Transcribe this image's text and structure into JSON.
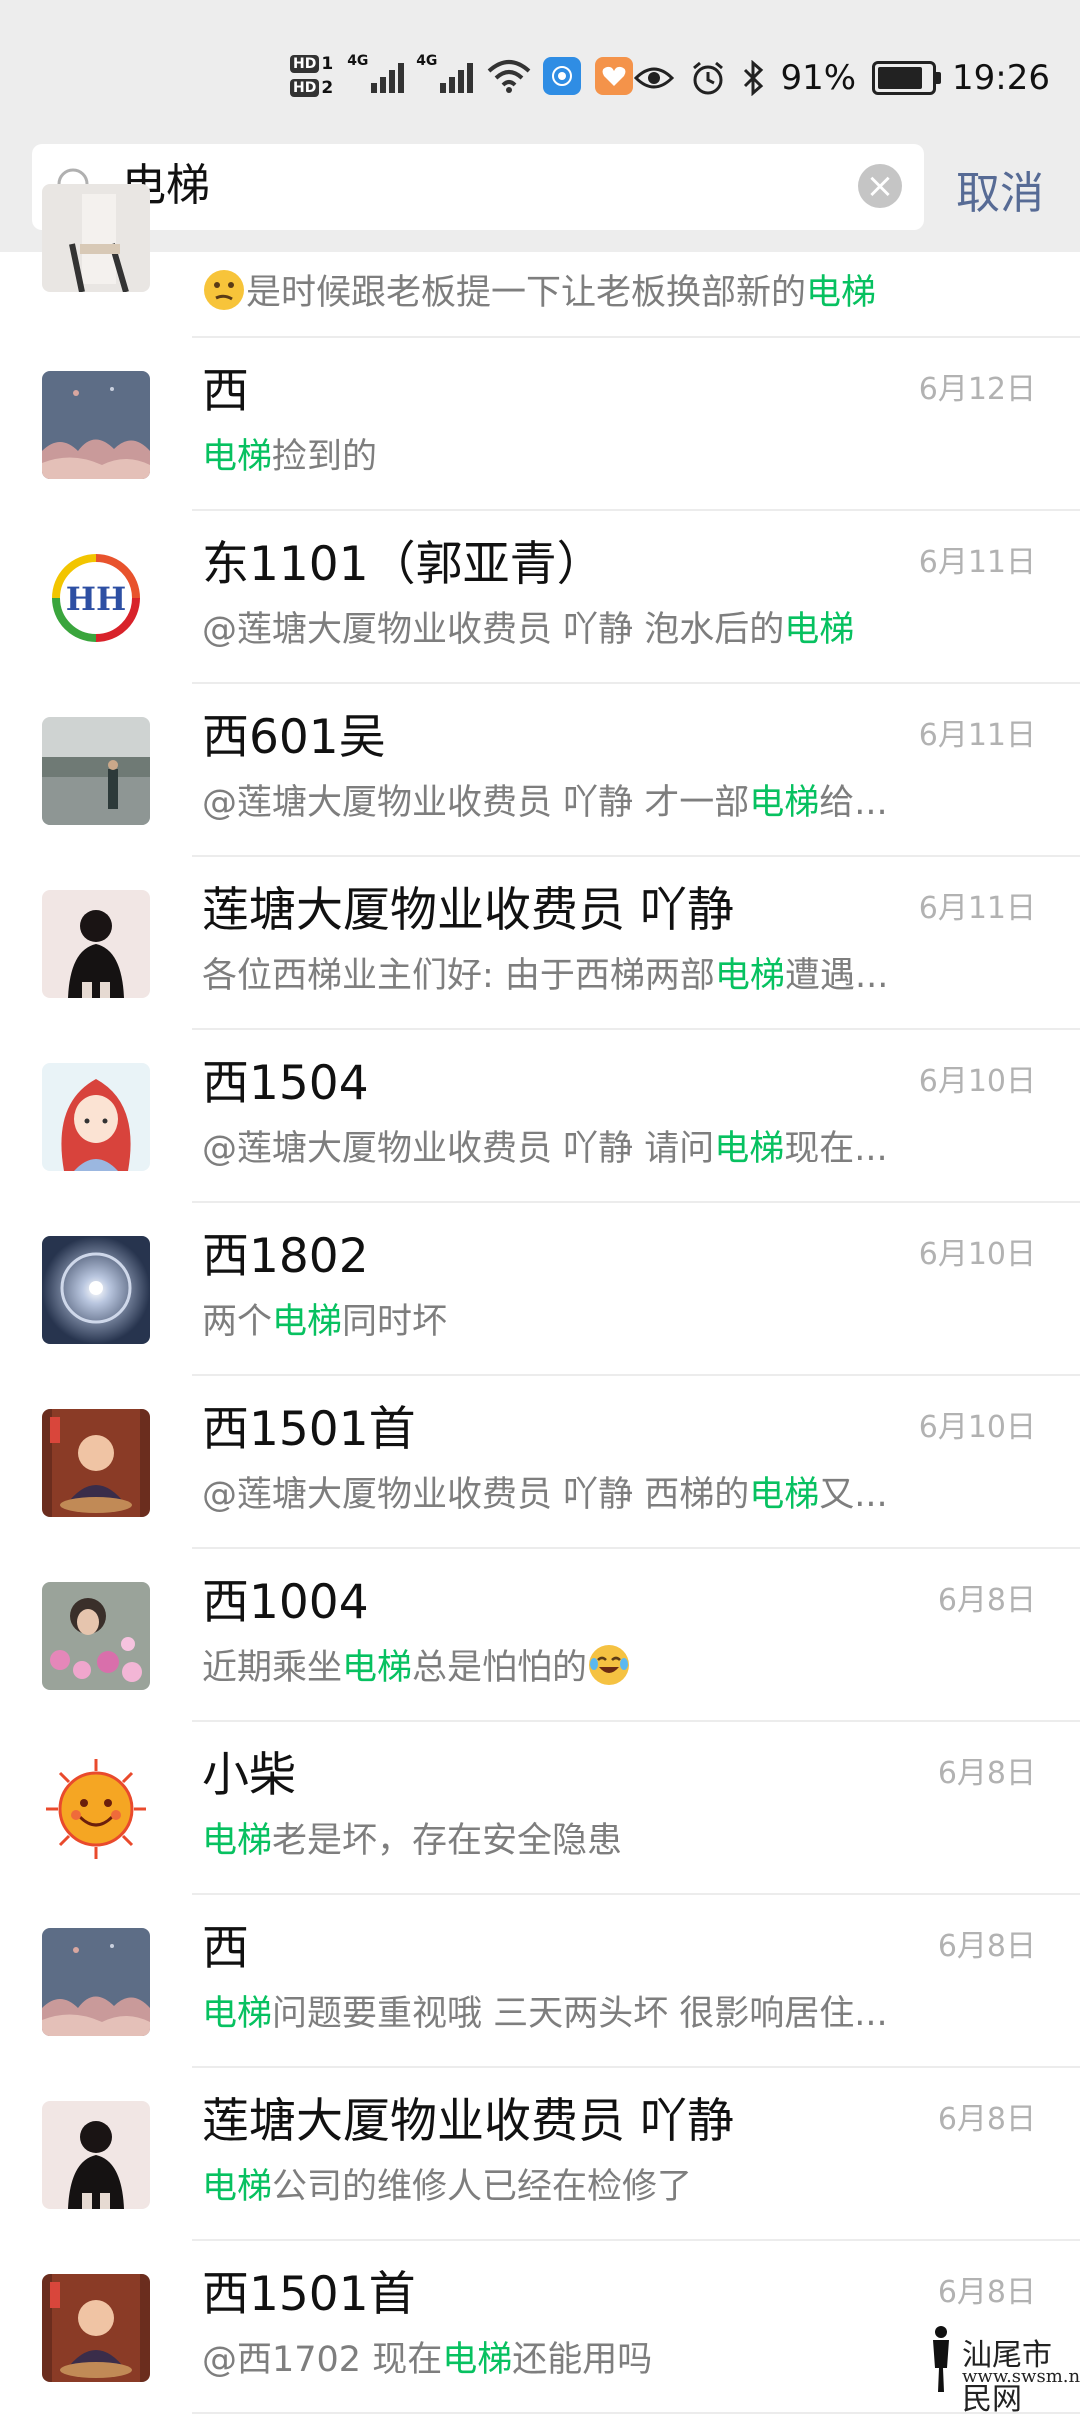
{
  "status_bar": {
    "hd1": "HD",
    "hd1_sub": "1",
    "hd2": "HD",
    "hd2_sub": "2",
    "net1": "4G",
    "net2": "4G",
    "battery_percent": "91%",
    "time": "19:26"
  },
  "search": {
    "query": "电梯",
    "clear_icon": "×",
    "cancel_label": "取消"
  },
  "results_partial": {
    "pre": "是时候跟老板提一下让老板换部新的",
    "hl": "电梯",
    "post": ""
  },
  "results": [
    {
      "name": "西",
      "date": "6月12日",
      "pre": "",
      "hl": "电梯",
      "post": "捡到的",
      "avatar": "landscape"
    },
    {
      "name": "东1101（郭亚青）",
      "date": "6月11日",
      "pre": "@莲塘大厦物业收费员  吖静 泡水后的",
      "hl": "电梯",
      "post": "",
      "avatar": "hh-logo"
    },
    {
      "name": "西601吴",
      "date": "6月11日",
      "pre": "@莲塘大厦物业收费员  吖静 才一部",
      "hl": "电梯",
      "post": "给...",
      "avatar": "photo-grey"
    },
    {
      "name": "莲塘大厦物业收费员  吖静",
      "date": "6月11日",
      "pre": "各位西梯业主们好: 由于西梯两部",
      "hl": "电梯",
      "post": "遭遇...",
      "avatar": "girl-dark"
    },
    {
      "name": "西1504",
      "date": "6月10日",
      "pre": "@莲塘大厦物业收费员  吖静 请问",
      "hl": "电梯",
      "post": "现在...",
      "avatar": "cartoon-redhair"
    },
    {
      "name": "西1802",
      "date": "6月10日",
      "pre": "两个",
      "hl": "电梯",
      "post": "同时坏",
      "avatar": "sun-halo"
    },
    {
      "name": "西1501首",
      "date": "6月10日",
      "pre": "@莲塘大厦物业收费员  吖静 西梯的",
      "hl": "电梯",
      "post": "又...",
      "avatar": "monk-figure"
    },
    {
      "name": "西1004",
      "date": "6月8日",
      "pre": "近期乘坐",
      "hl": "电梯",
      "post": "总是怕怕的",
      "emoji": "laugh",
      "avatar": "flowers"
    },
    {
      "name": "小柴",
      "date": "6月8日",
      "pre": "",
      "hl": "电梯",
      "post": "老是坏，存在安全隐患",
      "avatar": "sun-face"
    },
    {
      "name": "西",
      "date": "6月8日",
      "pre": "",
      "hl": "电梯",
      "post": "问题要重视哦 三天两头坏 很影响居住...",
      "avatar": "landscape"
    },
    {
      "name": "莲塘大厦物业收费员  吖静",
      "date": "6月8日",
      "pre": "",
      "hl": "电梯",
      "post": "公司的维修人已经在检修了",
      "avatar": "girl-dark"
    },
    {
      "name": "西1501首",
      "date": "6月8日",
      "pre": "@西1702 现在",
      "hl": "电梯",
      "post": "还能用吗",
      "avatar": "monk-figure"
    }
  ],
  "watermark": {
    "title": "汕尾市民网",
    "url": "www.swsm.net"
  }
}
